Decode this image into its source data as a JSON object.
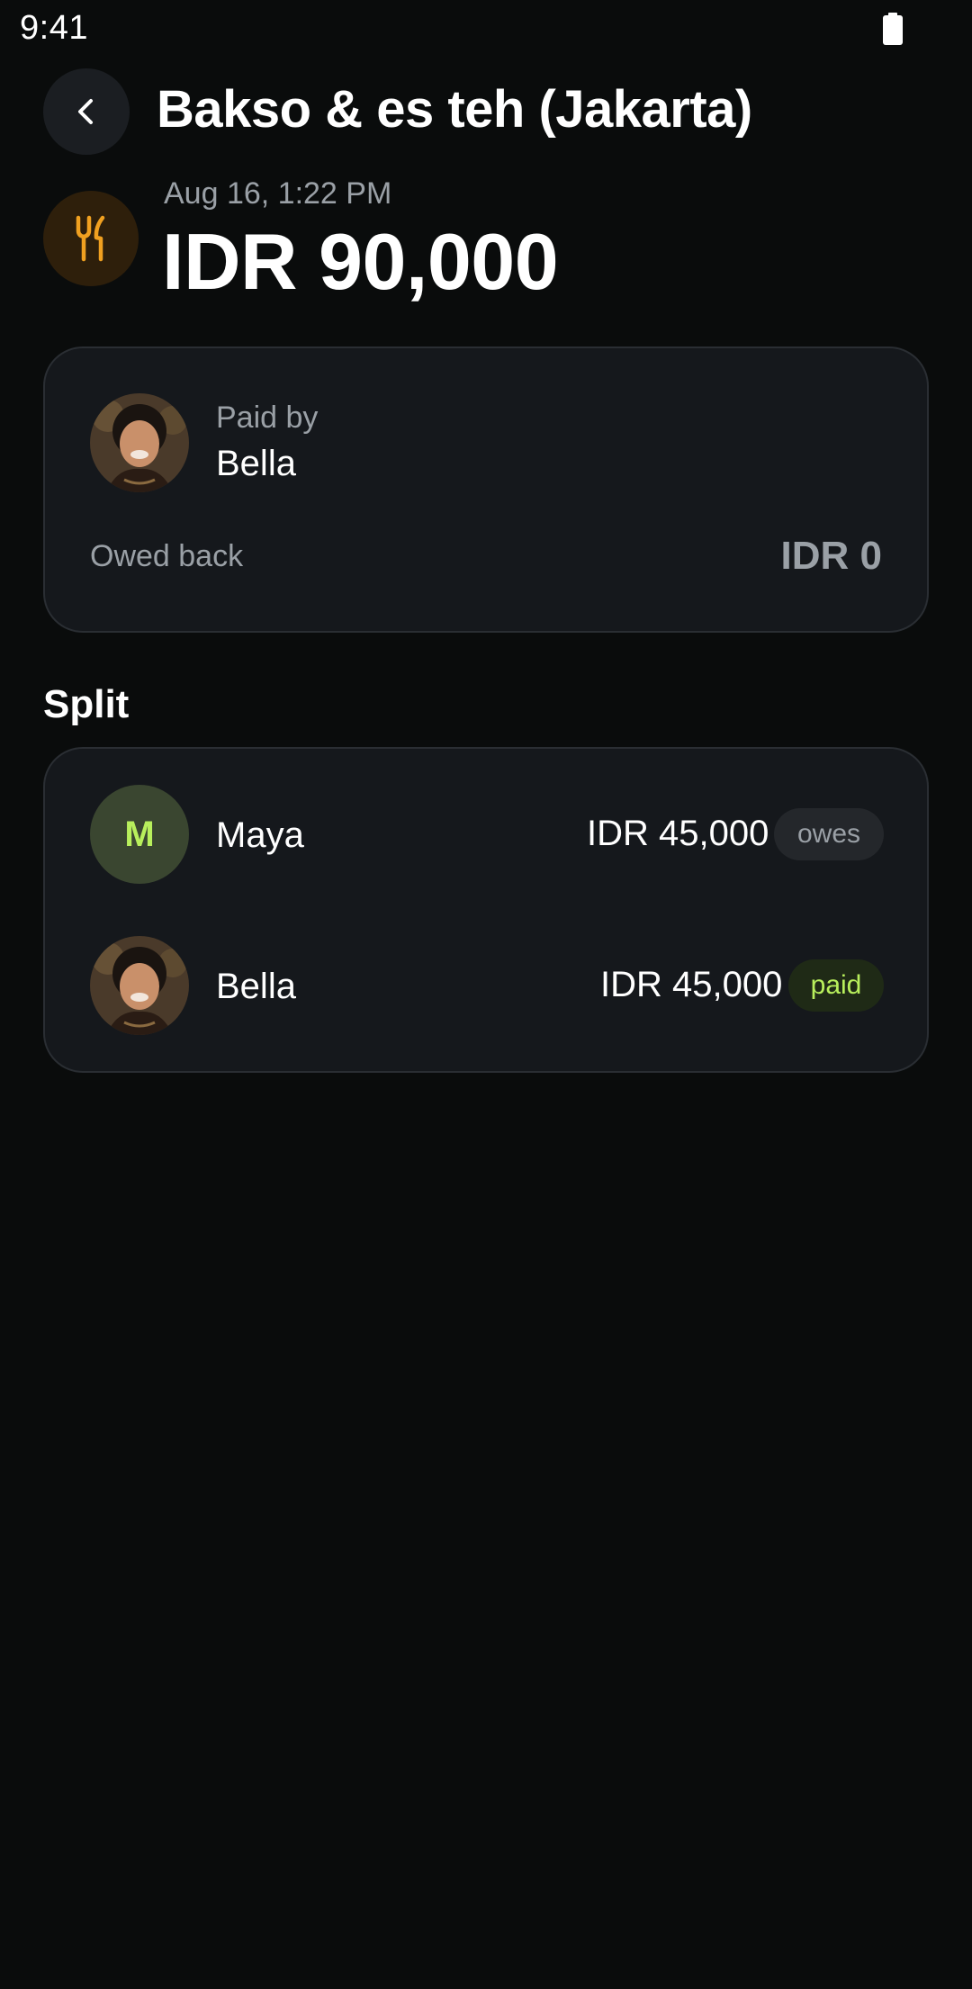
{
  "status_bar": {
    "time": "9:41"
  },
  "header": {
    "title": "Bakso & es teh (Jakarta)"
  },
  "expense": {
    "category_icon": "fork-knife-icon",
    "date": "Aug 16, 1:22 PM",
    "amount": "IDR 90,000"
  },
  "payer_card": {
    "paid_by_label": "Paid by",
    "payer_name": "Bella",
    "owed_back_label": "Owed back",
    "owed_back_value": "IDR 0"
  },
  "split": {
    "heading": "Split",
    "rows": [
      {
        "avatar_initial": "M",
        "name": "Maya",
        "amount": "IDR 45,000",
        "status": "owes"
      },
      {
        "avatar_initial": "",
        "name": "Bella",
        "amount": "IDR 45,000",
        "status": "paid"
      }
    ]
  },
  "colors": {
    "background": "#0a0c0c",
    "card": "#15181c",
    "accent_green": "#b8ef5c",
    "accent_orange": "#f0a020",
    "muted_text": "#9aa0a6"
  }
}
